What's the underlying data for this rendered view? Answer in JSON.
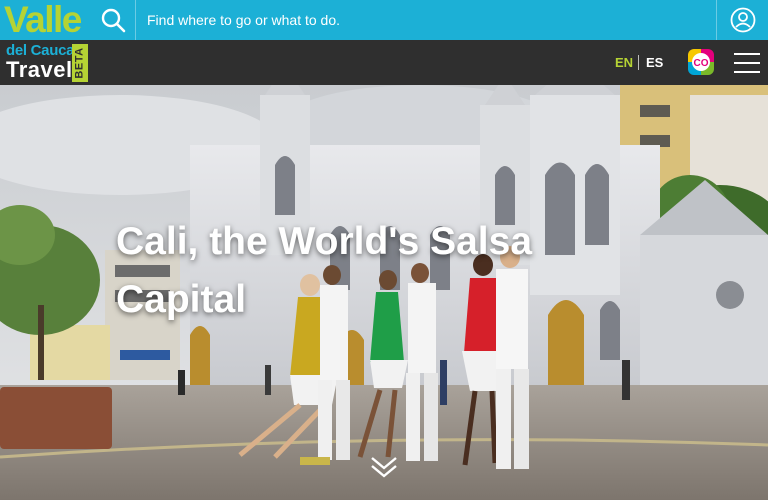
{
  "header": {
    "logo_valle": "Valle",
    "logo_delcauca": "del Cauca",
    "logo_travel": "Travel",
    "logo_beta": "BETA",
    "search_placeholder": "Find where to go or what to do."
  },
  "nav": {
    "lang_en": "EN",
    "lang_es": "ES",
    "badge_text": "CO"
  },
  "hero": {
    "title": "Cali, the World's Salsa Capital"
  },
  "colors": {
    "topbar": "#1cb0d6",
    "navbar": "#2f2f2f",
    "brand_green": "#b5d334",
    "brand_blue": "#1cb0d6"
  },
  "icons": {
    "search": "search-icon",
    "user": "user-icon",
    "menu": "hamburger-menu-icon",
    "scroll": "chevron-double-down-icon",
    "badge": "colombia-badge-icon"
  }
}
